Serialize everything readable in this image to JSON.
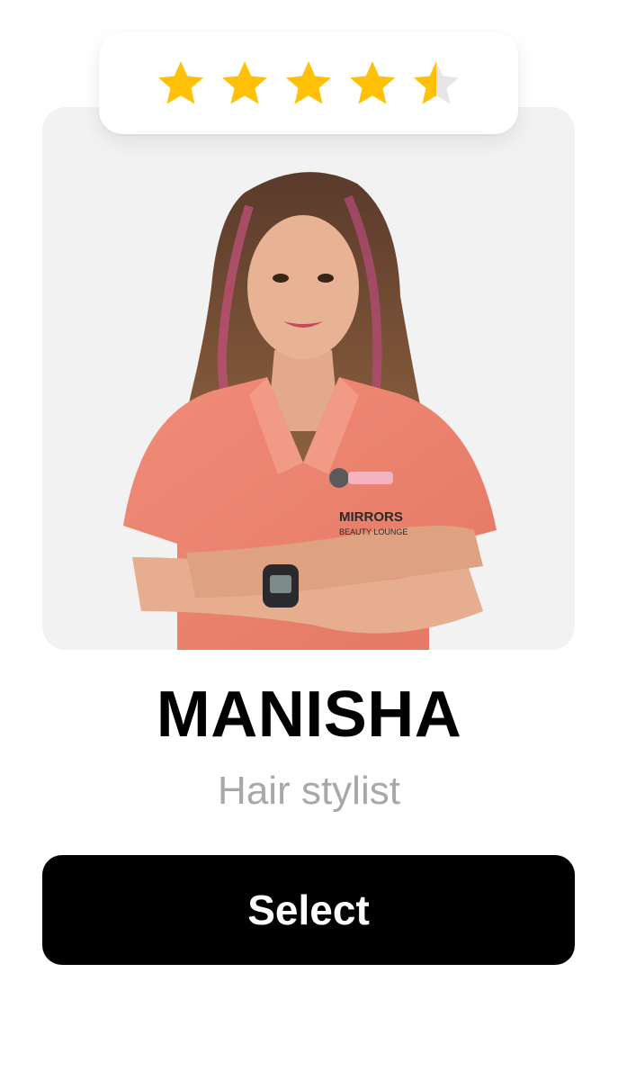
{
  "rating": {
    "value": 4.5,
    "max": 5,
    "filled_color": "#FFC107",
    "empty_color": "#E6E6E6"
  },
  "profile": {
    "photo_alt": "stylist-portrait",
    "badge_brand": "MIRRORS",
    "badge_sub": "BEAUTY LOUNGE",
    "name": "MANISHA",
    "role": "Hair stylist"
  },
  "actions": {
    "select_label": "Select"
  },
  "colors": {
    "card_bg": "#F2F2F2",
    "button_bg": "#000000",
    "role_text": "#A8A8A8"
  }
}
